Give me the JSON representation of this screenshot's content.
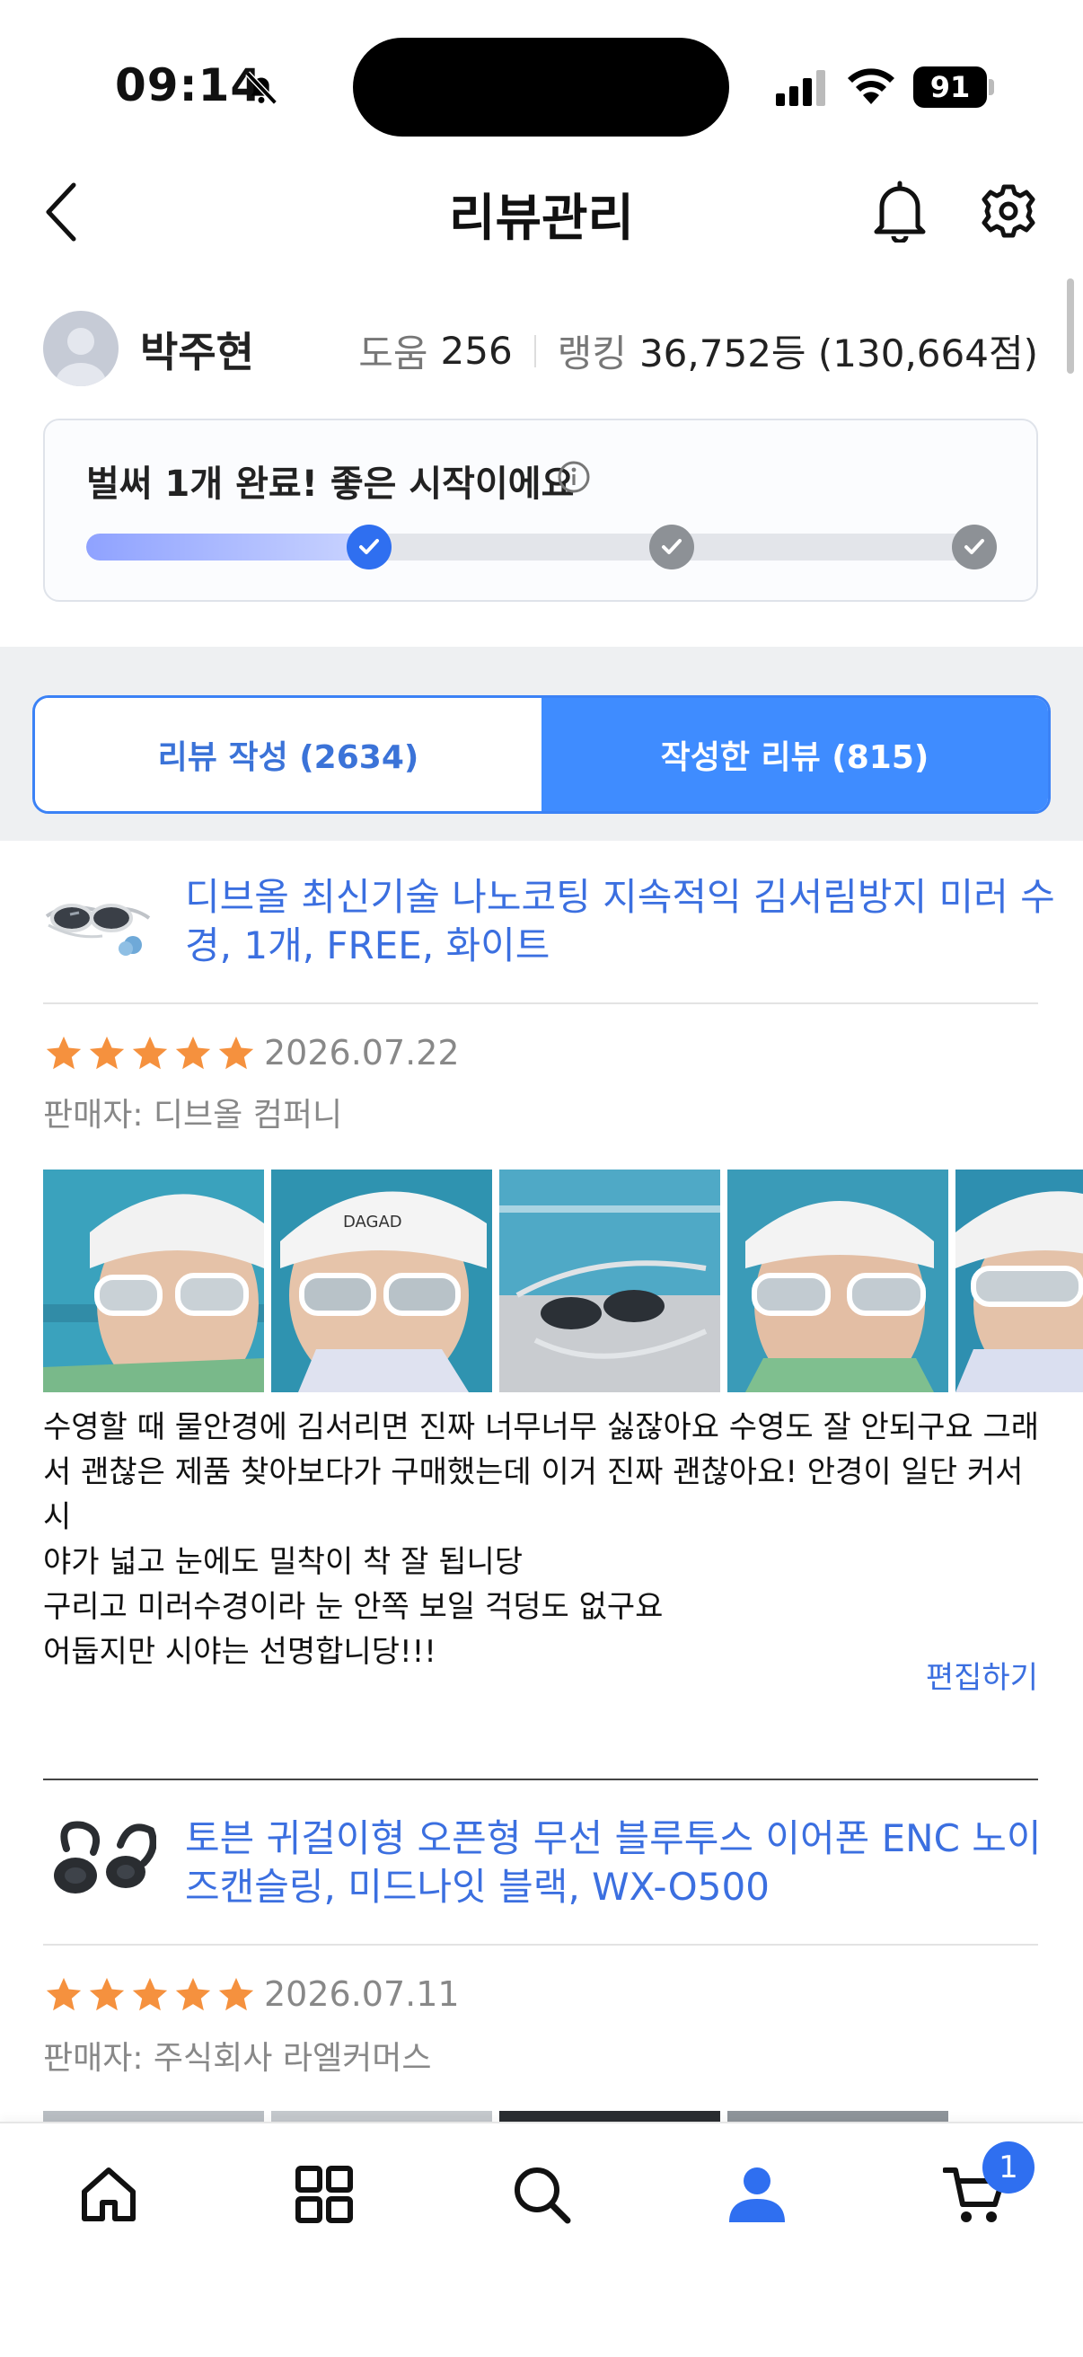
{
  "status_bar": {
    "time": "09:14",
    "battery": "91"
  },
  "header": {
    "title": "리뷰관리"
  },
  "profile": {
    "name": "박주현",
    "help_label": "도움",
    "help_count": "256",
    "rank_label": "랭킹",
    "rank_value": "36,752등 (130,664점)"
  },
  "progress": {
    "message": "벌써 1개 완료! 좋은 시작이에요",
    "completed": 1,
    "total": 3
  },
  "tabs": [
    {
      "label": "리뷰 작성 (2634)",
      "active": false
    },
    {
      "label": "작성한 리뷰 (815)",
      "active": true
    }
  ],
  "reviews": [
    {
      "product_title": "디브올 최신기술 나노코팅 지속적익 김서림방지 미러 수경, 1개, FREE, 화이트",
      "rating": 5,
      "date": "2026.07.22",
      "seller": "판매자: 디브올 컴퍼니",
      "photo_count": 5,
      "body_lines": [
        "수영할 때 물안경에 김서리면 진짜 너무너무 싫잖아요 수영도 잘 안되구요 그래",
        "서 괜찮은 제품 찾아보다가 구매했는데 이거 진짜 괜찮아요! 안경이 일단 커서 시",
        "야가 넓고 눈에도 밀착이 착 잘 됩니당",
        "구리고 미러수경이라 눈 안쪽 보일 걱덩도 없구요",
        "어둡지만 시야는 선명합니당!!!"
      ],
      "edit_label": "편집하기"
    },
    {
      "product_title": "토븐 귀걸이형 오픈형 무선 블루투스 이어폰 ENC 노이즈캔슬링, 미드나잇 블랙, WX-O500",
      "rating": 5,
      "date": "2026.07.11",
      "seller": "판매자: 주식회사 라엘커머스"
    }
  ],
  "bottom_nav": {
    "items": [
      "home-icon",
      "category-grid-icon",
      "search-icon",
      "profile-icon",
      "cart-icon"
    ],
    "active": "profile-icon",
    "cart_badge": "1"
  },
  "colors": {
    "accent": "#3f8cff",
    "link": "#3b6fe0",
    "star": "#f5913e"
  }
}
